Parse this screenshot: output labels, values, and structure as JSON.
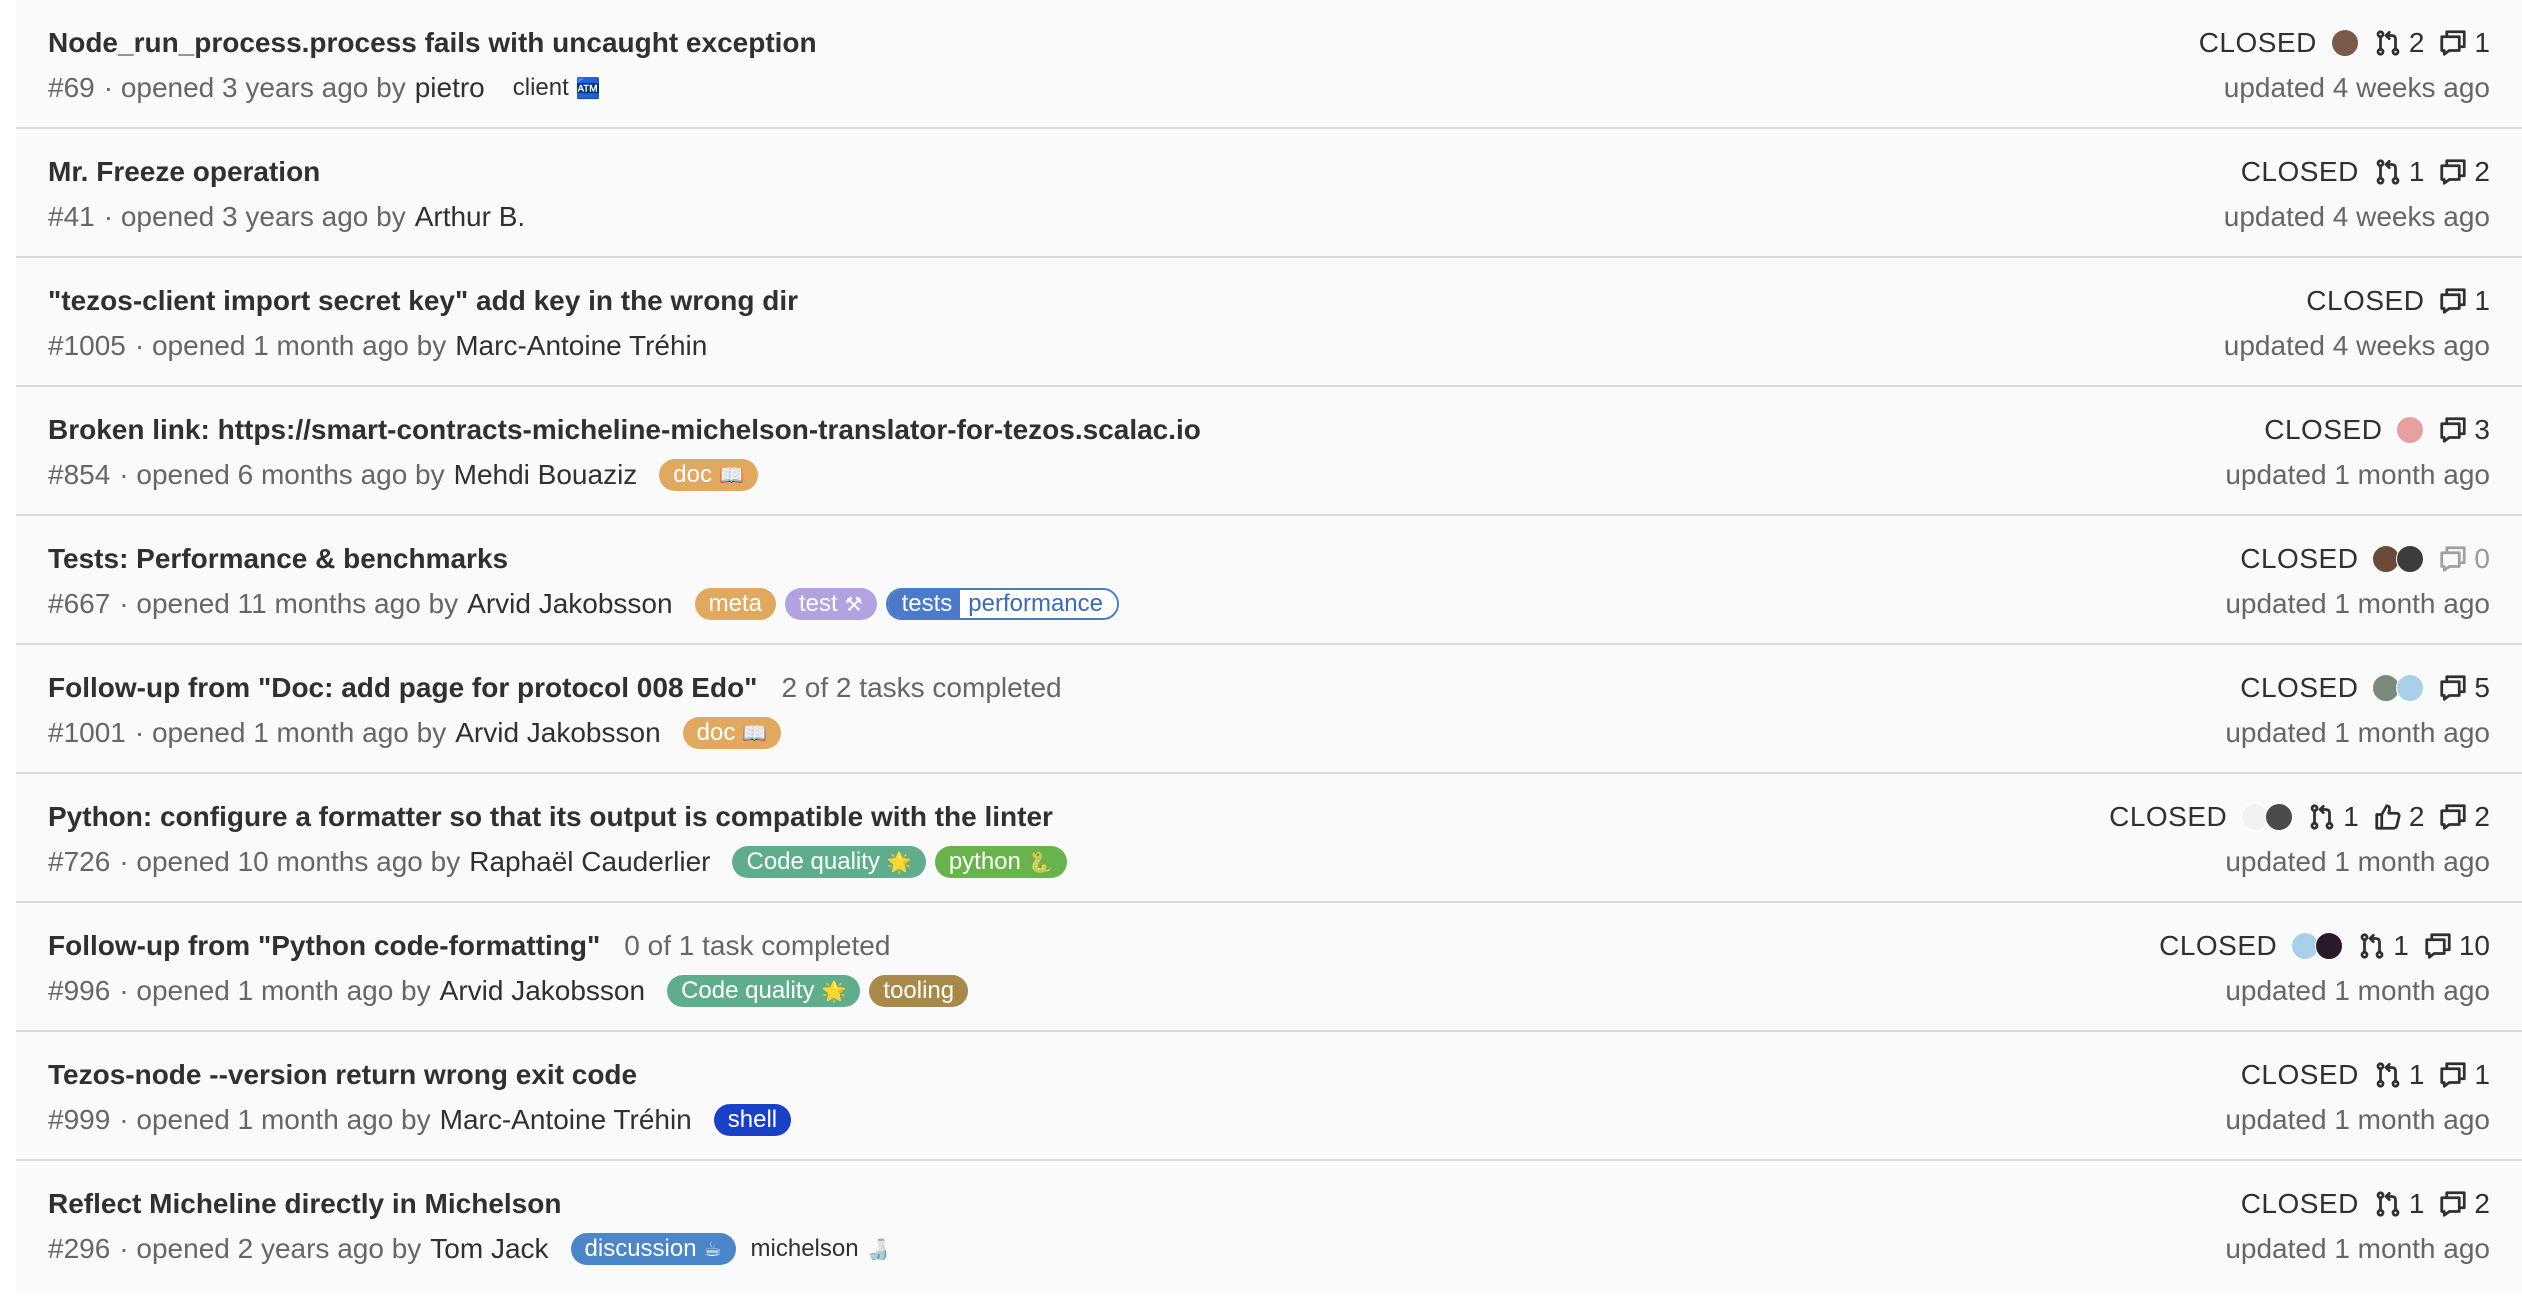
{
  "issues": [
    {
      "title": "Node_run_process.process fails with uncaught exception",
      "tasks": "",
      "number": "#69",
      "opened": "· opened 3 years ago by",
      "author": "pietro",
      "labels": [
        {
          "text": "client",
          "emoji": "🏧",
          "color": "plain"
        }
      ],
      "status": "CLOSED",
      "avatars": [
        "#7a5a48"
      ],
      "merge_requests": "2",
      "upvotes": "",
      "comments": "1",
      "updated": "updated 4 weeks ago"
    },
    {
      "title": "Mr. Freeze operation",
      "tasks": "",
      "number": "#41",
      "opened": "· opened 3 years ago by",
      "author": "Arthur B.",
      "labels": [],
      "status": "CLOSED",
      "avatars": [],
      "merge_requests": "1",
      "upvotes": "",
      "comments": "2",
      "updated": "updated 4 weeks ago"
    },
    {
      "title": "\"tezos-client import secret key\" add key in the wrong dir",
      "tasks": "",
      "number": "#1005",
      "opened": "· opened 1 month ago by",
      "author": "Marc-Antoine Tréhin",
      "labels": [],
      "status": "CLOSED",
      "avatars": [],
      "merge_requests": "",
      "upvotes": "",
      "comments": "1",
      "updated": "updated 4 weeks ago"
    },
    {
      "title": "Broken link: https://smart-contracts-micheline-michelson-translator-for-tezos.scalac.io",
      "tasks": "",
      "number": "#854",
      "opened": "· opened 6 months ago by",
      "author": "Mehdi Bouaziz",
      "labels": [
        {
          "text": "doc",
          "emoji": "📖",
          "color": "#e0a95f"
        }
      ],
      "status": "CLOSED",
      "avatars": [
        "#e6a0a0"
      ],
      "merge_requests": "",
      "upvotes": "",
      "comments": "3",
      "updated": "updated 1 month ago"
    },
    {
      "title": "Tests: Performance & benchmarks",
      "tasks": "",
      "number": "#667",
      "opened": "· opened 11 months ago by",
      "author": "Arvid Jakobsson",
      "labels": [
        {
          "text": "meta",
          "emoji": "",
          "color": "#e0a95f"
        },
        {
          "text": "test",
          "emoji": "⚒",
          "color": "#b3a2e0"
        },
        {
          "scoped": true,
          "key": "tests",
          "value": "performance"
        }
      ],
      "status": "CLOSED",
      "avatars": [
        "#6b4a3a",
        "#3c3c3c"
      ],
      "merge_requests": "",
      "upvotes": "",
      "comments": "0",
      "updated": "updated 1 month ago"
    },
    {
      "title": "Follow-up from \"Doc: add page for protocol 008 Edo\"",
      "tasks": "2 of 2 tasks completed",
      "number": "#1001",
      "opened": "· opened 1 month ago by",
      "author": "Arvid Jakobsson",
      "labels": [
        {
          "text": "doc",
          "emoji": "📖",
          "color": "#e0a95f"
        }
      ],
      "status": "CLOSED",
      "avatars": [
        "#7a8a7a",
        "#a8d0e8"
      ],
      "merge_requests": "",
      "upvotes": "",
      "comments": "5",
      "updated": "updated 1 month ago"
    },
    {
      "title": "Python: configure a formatter so that its output is compatible with the linter",
      "tasks": "",
      "number": "#726",
      "opened": "· opened 10 months ago by",
      "author": "Raphaël Cauderlier",
      "labels": [
        {
          "text": "Code quality",
          "emoji": "🌟",
          "color": "#5fad8c"
        },
        {
          "text": "python",
          "emoji": "🐍",
          "color": "#69b34c"
        }
      ],
      "status": "CLOSED",
      "avatars": [
        "#f2f2f2",
        "#4a4a4a"
      ],
      "merge_requests": "1",
      "upvotes": "2",
      "comments": "2",
      "updated": "updated 1 month ago"
    },
    {
      "title": "Follow-up from \"Python code-formatting\"",
      "tasks": "0 of 1 task completed",
      "number": "#996",
      "opened": "· opened 1 month ago by",
      "author": "Arvid Jakobsson",
      "labels": [
        {
          "text": "Code quality",
          "emoji": "🌟",
          "color": "#5fad8c"
        },
        {
          "text": "tooling",
          "emoji": "",
          "color": "#a8894a"
        }
      ],
      "status": "CLOSED",
      "avatars": [
        "#a8d0e8",
        "#2a1a2a"
      ],
      "merge_requests": "1",
      "upvotes": "",
      "comments": "10",
      "updated": "updated 1 month ago"
    },
    {
      "title": "Tezos-node --version return wrong exit code",
      "tasks": "",
      "number": "#999",
      "opened": "· opened 1 month ago by",
      "author": "Marc-Antoine Tréhin",
      "labels": [
        {
          "text": "shell",
          "emoji": "",
          "color": "#1a40c8"
        }
      ],
      "status": "CLOSED",
      "avatars": [],
      "merge_requests": "1",
      "upvotes": "",
      "comments": "1",
      "updated": "updated 1 month ago"
    },
    {
      "title": "Reflect Micheline directly in Michelson",
      "tasks": "",
      "number": "#296",
      "opened": "· opened 2 years ago by",
      "author": "Tom Jack",
      "labels": [
        {
          "text": "discussion",
          "emoji": "☕",
          "color": "#4a86c8"
        },
        {
          "text": "michelson",
          "emoji": "🍶",
          "color": "plain"
        }
      ],
      "status": "CLOSED",
      "avatars": [],
      "merge_requests": "1",
      "upvotes": "",
      "comments": "2",
      "updated": "updated 1 month ago"
    }
  ]
}
